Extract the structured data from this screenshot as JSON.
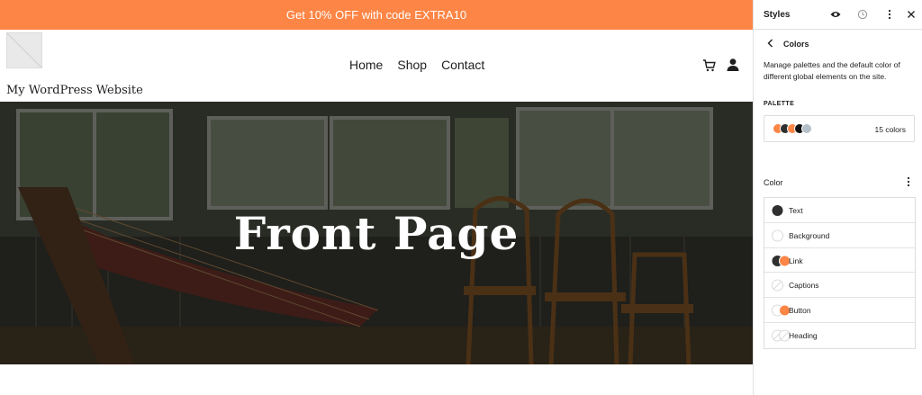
{
  "promo": {
    "text": "Get 10% OFF with code EXTRA10"
  },
  "site": {
    "title": "My WordPress Website"
  },
  "nav": {
    "items": [
      {
        "label": "Home"
      },
      {
        "label": "Shop"
      },
      {
        "label": "Contact"
      }
    ]
  },
  "hero": {
    "title": "Front Page"
  },
  "panel": {
    "title": "Styles",
    "subtitle": "Colors",
    "description": "Manage palettes and the default color of different global elements on the site.",
    "palette_label": "PALETTE",
    "palette_count": "15 colors",
    "palette_swatches": [
      "#fd8545",
      "#2f2f2f",
      "#fd8545",
      "#111111",
      "#b5bfc9"
    ],
    "color_label": "Color",
    "elements": [
      {
        "label": "Text",
        "icon": "solid-circle-dark"
      },
      {
        "label": "Background",
        "icon": "empty-circle"
      },
      {
        "label": "Link",
        "icon": "dark-orange-pair"
      },
      {
        "label": "Captions",
        "icon": "crossed-circle"
      },
      {
        "label": "Button",
        "icon": "light-orange-pair"
      },
      {
        "label": "Heading",
        "icon": "crossed-circle-pair"
      }
    ]
  },
  "colors": {
    "accent": "#fd8545",
    "text": "#2f2f2f"
  }
}
